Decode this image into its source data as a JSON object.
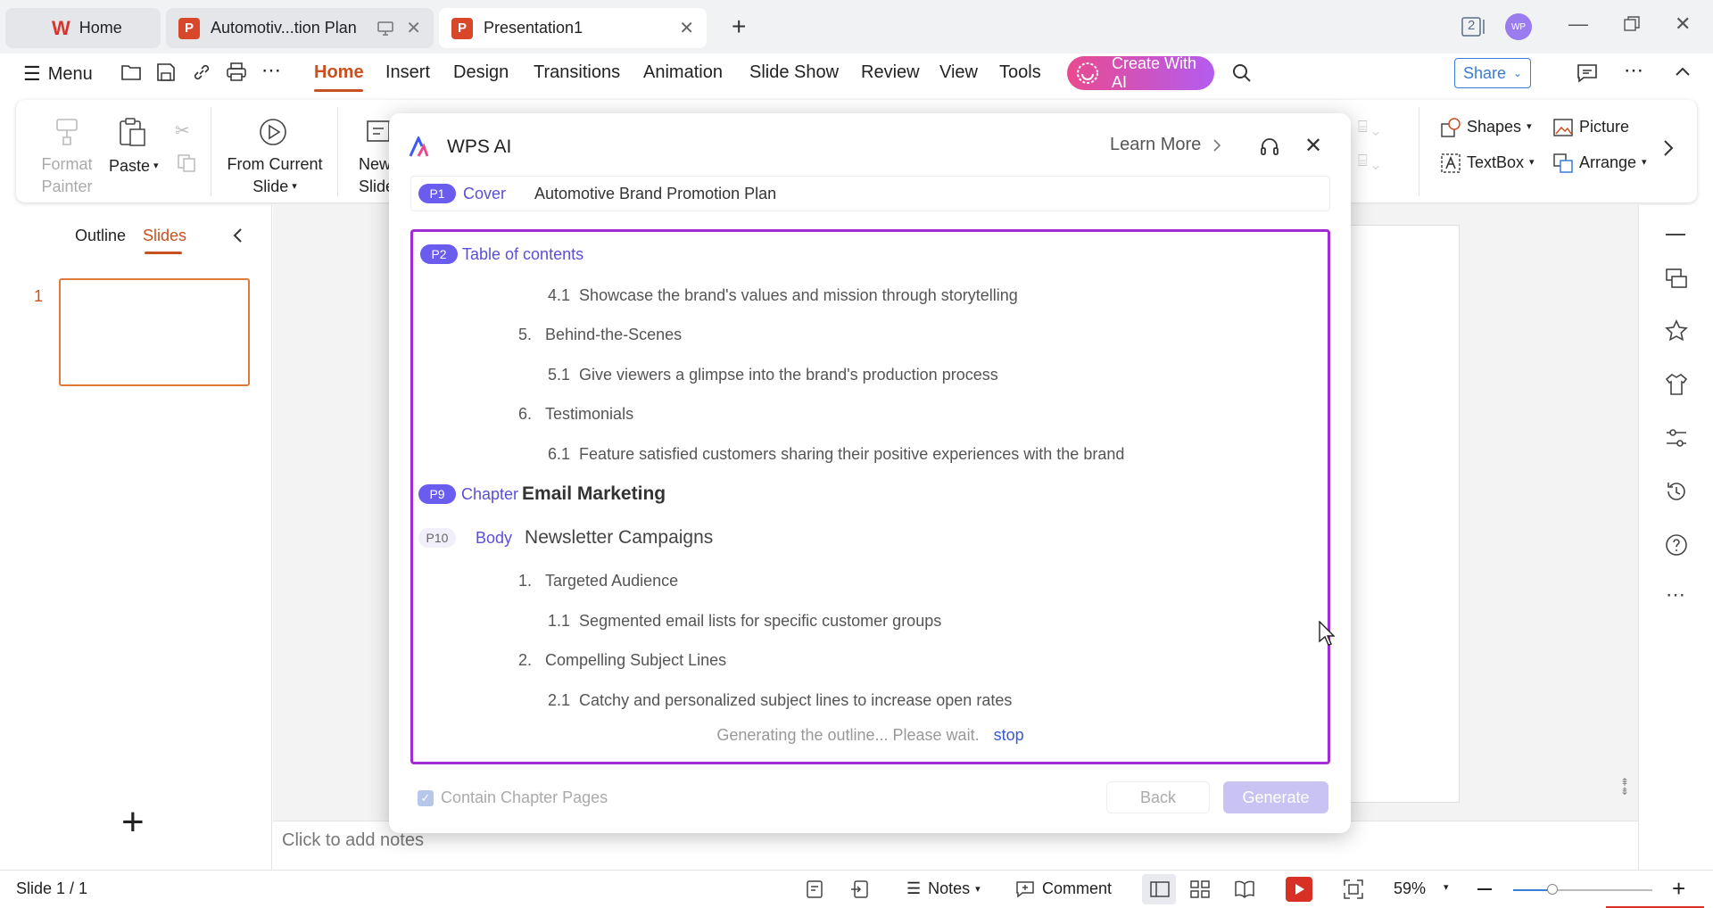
{
  "tabs": {
    "home": "Home",
    "doc1": "Automotiv...tion Plan",
    "doc2": "Presentation1"
  },
  "window": {
    "avatar_initials": "WP",
    "badge": "2"
  },
  "menubar": {
    "menu": "Menu",
    "items": [
      "Home",
      "Insert",
      "Design",
      "Transitions",
      "Animation",
      "Slide Show",
      "Review",
      "View",
      "Tools"
    ],
    "create_ai": "Create With AI",
    "share": "Share"
  },
  "ribbon": {
    "format_painter_1": "Format",
    "format_painter_2": "Painter",
    "paste": "Paste",
    "from_current_1": "From Current",
    "from_current_2": "Slide",
    "new_slide_1": "New",
    "new_slide_2": "Slide",
    "shapes": "Shapes",
    "picture": "Picture",
    "textbox": "TextBox",
    "arrange": "Arrange"
  },
  "leftpanel": {
    "outline_tab": "Outline",
    "slides_tab": "Slides",
    "slide_number": "1"
  },
  "notes_placeholder": "Click to add notes",
  "statusbar": {
    "slide_info": "Slide 1 / 1",
    "notes": "Notes",
    "comment": "Comment",
    "zoom": "59%"
  },
  "dialog": {
    "title": "WPS AI",
    "learn_more": "Learn More",
    "cover": {
      "badge": "P1",
      "type": "Cover",
      "title": "Automotive Brand Promotion Plan"
    },
    "toc": {
      "badge": "P2",
      "type": "Table of contents"
    },
    "outline_items": [
      {
        "num": "4.1",
        "text": "Showcase the brand's values and mission through storytelling",
        "level": 2
      },
      {
        "num": "5.",
        "text": "Behind-the-Scenes",
        "level": 1
      },
      {
        "num": "5.1",
        "text": "Give viewers a glimpse into the brand's production process",
        "level": 2
      },
      {
        "num": "6.",
        "text": "Testimonials",
        "level": 1
      },
      {
        "num": "6.1",
        "text": "Feature satisfied customers sharing their positive experiences with the brand",
        "level": 2
      }
    ],
    "chapter": {
      "badge": "P9",
      "type": "Chapter",
      "title": "Email Marketing"
    },
    "body": {
      "badge": "P10",
      "type": "Body",
      "title": "Newsletter Campaigns"
    },
    "body_items": [
      {
        "num": "1.",
        "text": "Targeted Audience",
        "level": 1
      },
      {
        "num": "1.1",
        "text": "Segmented email lists for specific customer groups",
        "level": 2
      },
      {
        "num": "2.",
        "text": "Compelling Subject Lines",
        "level": 1
      },
      {
        "num": "2.1",
        "text": "Catchy and personalized subject lines to increase open rates",
        "level": 2
      }
    ],
    "status": "Generating the outline... Please wait.",
    "stop": "stop",
    "contain_chapter": "Contain Chapter Pages",
    "back": "Back",
    "generate": "Generate"
  },
  "colors": {
    "accent": "#c9501f",
    "ai_purple": "#a02cd6",
    "badge": "#6b5cf0"
  }
}
